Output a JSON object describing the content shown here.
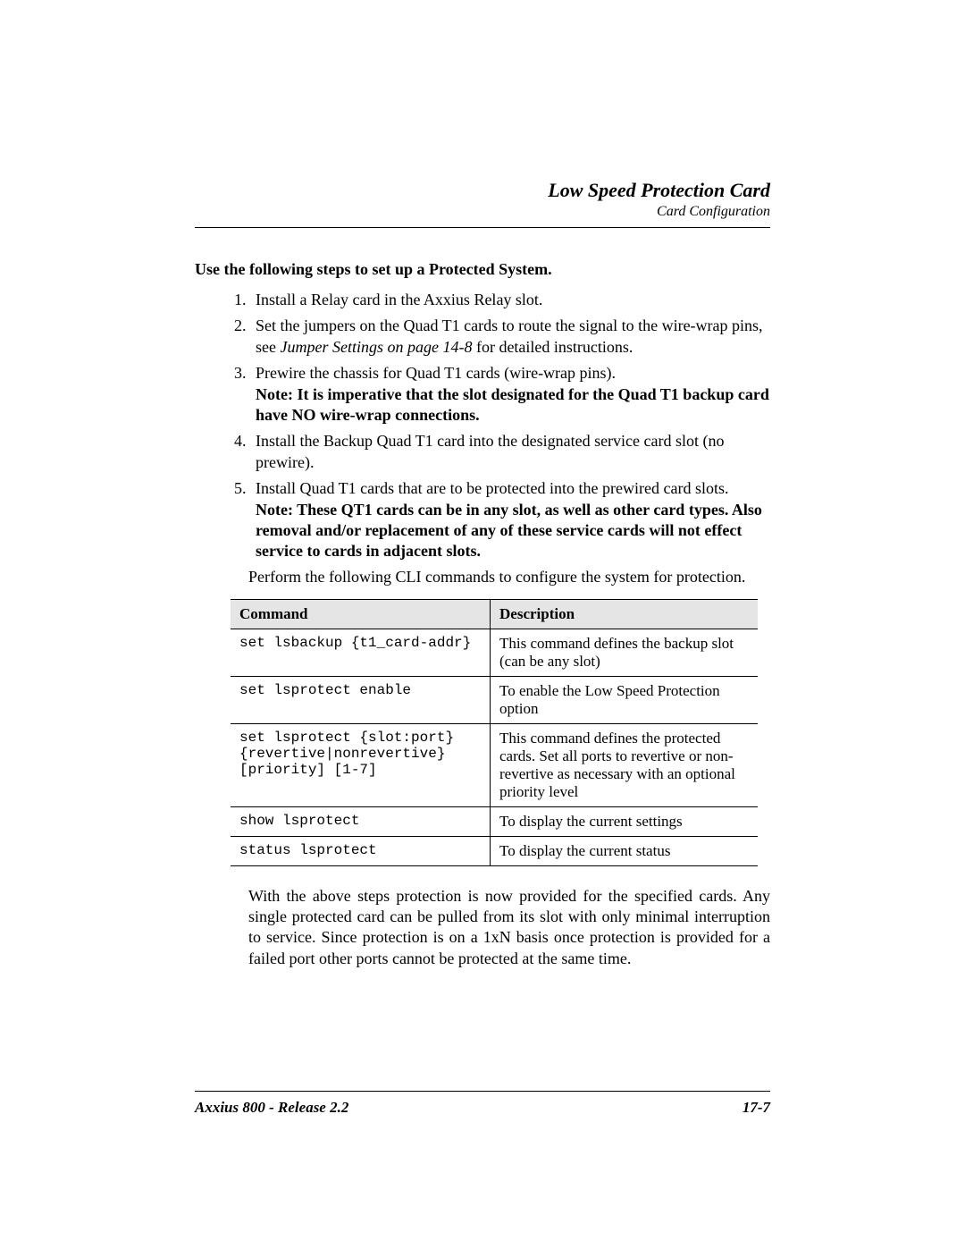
{
  "header": {
    "title": "Low Speed Protection Card",
    "subtitle": "Card Configuration"
  },
  "intro": "Use the following steps to set up a Protected System.",
  "steps": {
    "s1": "Install a Relay card in the Axxius Relay slot.",
    "s2a": "Set the jumpers on the Quad T1 cards to route the signal to the wire-wrap pins, see ",
    "s2i": "Jumper Settings on page 14-8",
    "s2b": " for detailed instructions.",
    "s3a": "Prewire the chassis for Quad T1 cards (wire-wrap pins).",
    "s3note": "Note: It is imperative that the slot designated for the Quad T1 backup card have NO wire-wrap connections.",
    "s4": "Install the Backup Quad T1 card into the designated service card slot (no prewire).",
    "s5a": "Install Quad T1 cards that are to be protected into the prewired card slots.",
    "s5note": "Note: These QT1 cards can be in any slot, as well as other card types. Also removal and/or replacement of any of these service cards will not effect service to cards in adjacent slots."
  },
  "perform": "Perform the following CLI commands to configure the system for protection.",
  "table": {
    "h1": "Command",
    "h2": "Description",
    "r1c1": "set lsbackup {t1_card-addr}",
    "r1c2": "This command defines the backup slot (can be any slot)",
    "r2c1": "set lsprotect enable",
    "r2c2": "To enable the Low Speed Protection option",
    "r3c1": "set lsprotect {slot:port}\n{revertive|nonrevertive}\n[priority] [1-7]",
    "r3c2": "This command defines the protected cards. Set all ports to revertive or non-revertive as necessary with an optional priority level",
    "r4c1": "show lsprotect",
    "r4c2": "To display the current settings",
    "r5c1": "status lsprotect",
    "r5c2": "To display the current status"
  },
  "closing": "With the above steps protection is now provided for the specified cards. Any single protected card can be pulled from its slot with only minimal interruption to service. Since protection is on a 1xN basis once protection is provided for a failed port other ports cannot be protected at the same time.",
  "footer": {
    "left": "Axxius 800 - Release 2.2",
    "right": "17-7"
  }
}
